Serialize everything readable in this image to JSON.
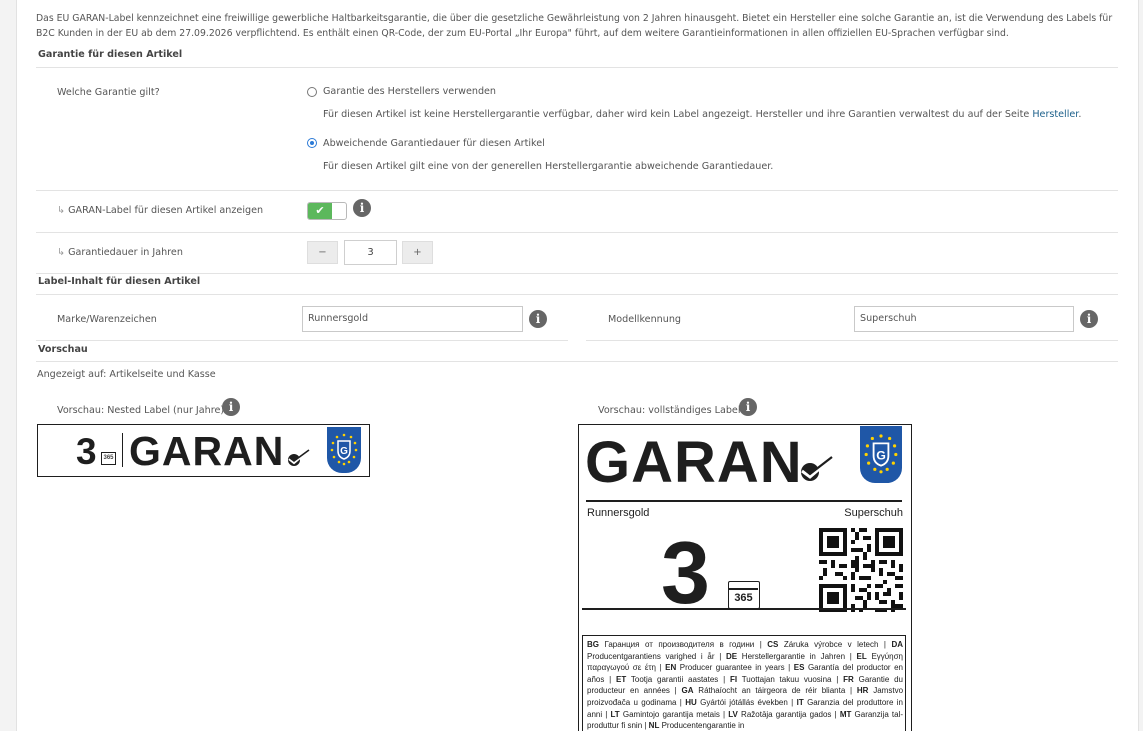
{
  "intro": {
    "text": "Das EU GARAN-Label kennzeichnet eine freiwillige gewerbliche Haltbarkeitsgarantie, die über die gesetzliche Gewährleistung von 2 Jahren hinausgeht. Bietet ein Hersteller eine solche Garantie an, ist die Verwendung des Labels für B2C Kunden in der EU ab dem 27.09.2026 verpflichtend. Es enthält einen QR-Code, der zum EU-Portal „Ihr Europa\" führt, auf dem weitere Garantieinformationen in allen offiziellen EU-Sprachen verfügbar sind."
  },
  "garantie": {
    "section_title": "Garantie für diesen Artikel",
    "which_label": "Welche Garantie gilt?",
    "option1_label": "Garantie des Herstellers verwenden",
    "option1_desc": "Für diesen Artikel ist keine Herstellergarantie verfügbar, daher wird kein Label angezeigt. Hersteller und ihre Garantien verwaltest du auf der Seite",
    "option1_link": "Hersteller",
    "option1_period": ".",
    "option2_label": "Abweichende Garantiedauer für diesen Artikel",
    "option2_desc": "Für diesen Artikel gilt eine von der generellen Herstellergarantie abweichende Garantiedauer.",
    "selected_option": "option2",
    "show_label": "GARAN-Label für diesen Artikel anzeigen",
    "show_label_enabled": true,
    "duration_label": "Garantiedauer in Jahren",
    "duration_value": "3",
    "minus": "−",
    "plus": "+"
  },
  "label_content": {
    "section_title": "Label-Inhalt für diesen Artikel",
    "brand_label": "Marke/Warenzeichen",
    "brand_value": "Runnersgold",
    "model_label": "Modellkennung",
    "model_value": "Superschuh"
  },
  "preview": {
    "section_title": "Vorschau",
    "shown_on": "Angezeigt auf: Artikelseite und Kasse",
    "nested_title": "Vorschau: Nested Label (nur Jahre)",
    "full_title": "Vorschau: vollständiges Label",
    "garan_text": "GARAN",
    "years": "3",
    "calendar_text": "365",
    "brand": "Runnersgold",
    "model": "Superschuh",
    "languages": [
      {
        "code": "BG",
        "text": "Гаранция от производителя в години"
      },
      {
        "code": "CS",
        "text": "Záruka výrobce v letech"
      },
      {
        "code": "DA",
        "text": "Producentgarantiens varighed i år"
      },
      {
        "code": "DE",
        "text": "Herstellergarantie in Jahren"
      },
      {
        "code": "EL",
        "text": "Εγγύηση παραγωγού σε έτη"
      },
      {
        "code": "EN",
        "text": "Producer guarantee in years"
      },
      {
        "code": "ES",
        "text": "Garantía del productor en años"
      },
      {
        "code": "ET",
        "text": "Tootja garantii aastates"
      },
      {
        "code": "FI",
        "text": "Tuottajan takuu vuosina"
      },
      {
        "code": "FR",
        "text": "Garantie du producteur en années"
      },
      {
        "code": "GA",
        "text": "Ráthaíocht an táirgeora de réir blianta"
      },
      {
        "code": "HR",
        "text": "Jamstvo proizvođača u godinama"
      },
      {
        "code": "HU",
        "text": "Gyártói jótállás években"
      },
      {
        "code": "IT",
        "text": "Garanzia del produttore in anni"
      },
      {
        "code": "LT",
        "text": "Gamintojo garantija metais"
      },
      {
        "code": "LV",
        "text": "Ražotāja garantija gados"
      },
      {
        "code": "MT",
        "text": "Garanzija tal-produttur fi snin"
      },
      {
        "code": "NL",
        "text": "Producentengarantie in"
      }
    ]
  },
  "colors": {
    "toggle_on": "#5cb85c",
    "radio_selected": "#2c7ad6",
    "link": "#1b5f8a",
    "eu_blue": "#1f57a7",
    "eu_star": "#ffd200"
  },
  "icons": [
    "info-icon",
    "check-icon",
    "checkmark-swoosh-icon",
    "calendar-icon",
    "qr-code",
    "eu-shield-logo"
  ]
}
